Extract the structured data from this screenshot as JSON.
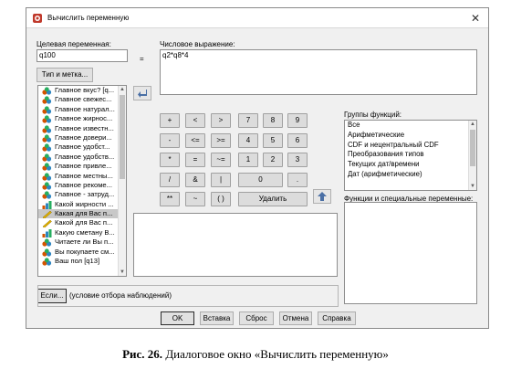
{
  "window": {
    "title": "Вычислить переменную",
    "close_glyph": "✕"
  },
  "target": {
    "label": "Целевая переменная:",
    "value": "q100",
    "type_button": "Тип и метка..."
  },
  "equals": "=",
  "expression": {
    "label": "Числовое выражение:",
    "value": "q2*q8*4"
  },
  "variables": [
    {
      "label": "Главное вкус? [q...",
      "icon": "nominal-icon"
    },
    {
      "label": "Главное свежес...",
      "icon": "nominal-icon"
    },
    {
      "label": "Главное натурал...",
      "icon": "nominal-icon"
    },
    {
      "label": "Главное жирнос...",
      "icon": "nominal-icon"
    },
    {
      "label": "Главное известн...",
      "icon": "nominal-icon"
    },
    {
      "label": "Главное довери...",
      "icon": "nominal-icon"
    },
    {
      "label": "Главное  удобст...",
      "icon": "nominal-icon"
    },
    {
      "label": "Главное удобств...",
      "icon": "nominal-icon"
    },
    {
      "label": "Главное привле...",
      "icon": "nominal-icon"
    },
    {
      "label": "Главное местны...",
      "icon": "nominal-icon"
    },
    {
      "label": "Главное рекоме...",
      "icon": "nominal-icon"
    },
    {
      "label": "Главное - затруд...",
      "icon": "nominal-icon"
    },
    {
      "label": "Какой жирности ...",
      "icon": "ordinal-icon"
    },
    {
      "label": "Какая для Вас п...",
      "icon": "scale-icon"
    },
    {
      "label": "Какой для Вас п...",
      "icon": "scale-icon"
    },
    {
      "label": "Какую сметану В...",
      "icon": "ordinal-icon"
    },
    {
      "label": "Читаете ли Вы п...",
      "icon": "nominal-icon"
    },
    {
      "label": "Вы покупаете см...",
      "icon": "nominal-icon"
    },
    {
      "label": "Ваш пол  [q13]",
      "icon": "nominal-icon"
    }
  ],
  "keypad": [
    [
      "+",
      "<",
      ">",
      "7",
      "8",
      "9"
    ],
    [
      "-",
      "<=",
      ">=",
      "4",
      "5",
      "6"
    ],
    [
      "*",
      "=",
      "~=",
      "1",
      "2",
      "3"
    ],
    [
      "/",
      "&",
      "|",
      "0",
      "."
    ],
    [
      "**",
      "~",
      "( )",
      "Удалить"
    ]
  ],
  "functions": {
    "groups_label": "Группы функций:",
    "groups": [
      "Все",
      "Арифметические",
      "CDF и нецентральный CDF",
      "Преобразования типов",
      "Текущих дат/времени",
      "Дат (арифметические)"
    ],
    "special_label": "Функции и специальные переменные:"
  },
  "if_button": "Если...",
  "if_condition": "(условие отбора наблюдений)",
  "footer": [
    "OK",
    "Вставка",
    "Сброс",
    "Отмена",
    "Справка"
  ],
  "caption": {
    "bold": "Рис. 26.",
    "text": " Диалоговое окно «Вычислить переменную»"
  },
  "colors": {
    "dialog_bg": "#f0f0f0",
    "selected_row": "#c8c8c8"
  }
}
